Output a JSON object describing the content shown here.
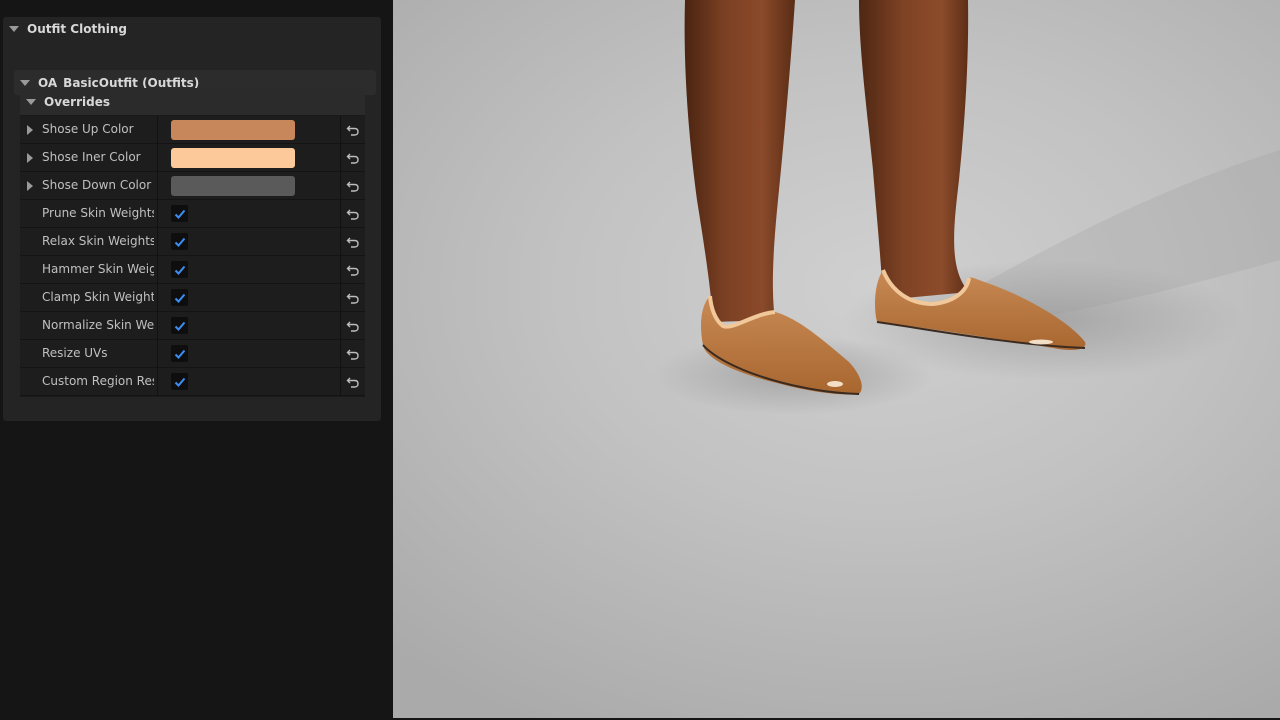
{
  "panel": {
    "section_title": "Outfit Clothing",
    "outfit_title": "OA_BasicOutfit (Outfits)",
    "overrides_title": "Overrides",
    "color_rows": [
      {
        "label": "Shose Up Color",
        "color": "#c8875a"
      },
      {
        "label": "Shose Iner Color",
        "color": "#fcc99a"
      },
      {
        "label": "Shose Down Color",
        "color": "#5a5a5a"
      }
    ],
    "check_rows": [
      {
        "label": "Prune Skin Weights",
        "checked": true
      },
      {
        "label": "Relax Skin Weights",
        "checked": true
      },
      {
        "label": "Hammer Skin Weig...",
        "checked": true
      },
      {
        "label": "Clamp Skin Weights",
        "checked": true
      },
      {
        "label": "Normalize Skin Wei...",
        "checked": true
      },
      {
        "label": "Resize UVs",
        "checked": true
      },
      {
        "label": "Custom Region Resi...",
        "checked": true
      }
    ]
  },
  "colors": {
    "checkmark": "#3d8ef2",
    "panel_bg": "#151515",
    "viewport_bg": "#c6c6c6"
  }
}
